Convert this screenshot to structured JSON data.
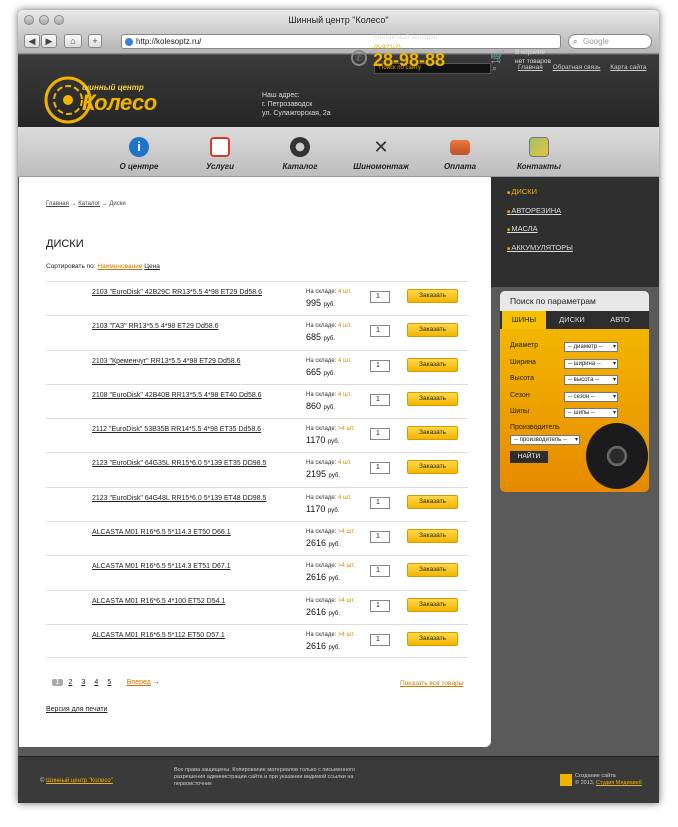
{
  "window": {
    "title": "Шинный центр \"Колесо\"",
    "url": "http://kolesoptz.ru/",
    "search_placeholder": "Google"
  },
  "header": {
    "search_placeholder": "Поиск по сайту",
    "toplinks": [
      "Главная",
      "Обратная связь",
      "Карта сайта"
    ],
    "logo_line1": "шинный центр",
    "logo_line2": "Колесо",
    "address": [
      "Наш адрес:",
      "г. Петрозаводск",
      "ул. Сулажгорская, 2а"
    ],
    "phone_label": "Контактный телефон:",
    "phone_code": "(8-921-2)",
    "phone_number": "28-98-88",
    "cart_line1": "В корзине",
    "cart_line2": "нет товаров"
  },
  "nav": [
    {
      "label": "О центре",
      "icon": "info-icon",
      "color": "#1e73c8"
    },
    {
      "label": "Услуги",
      "icon": "document-icon",
      "color": "#d83a2a"
    },
    {
      "label": "Каталог",
      "icon": "tire-icon",
      "color": "#333333"
    },
    {
      "label": "Шиномонтаж",
      "icon": "wrench-icon",
      "color": "#333333"
    },
    {
      "label": "Оплата",
      "icon": "credit-card-icon",
      "color": "#d06a2a"
    },
    {
      "label": "Контакты",
      "icon": "map-icon",
      "color": "#7aa84a"
    }
  ],
  "breadcrumb": {
    "home": "Главная",
    "catalog": "Каталог",
    "current": "Диски",
    "sep": "→"
  },
  "page_title": "ДИСКИ",
  "sort": {
    "label": "Сортировать по:",
    "by_name": "Наименование",
    "by_price": "Цена"
  },
  "products": [
    {
      "name": "2103 \"EuroDisk\" 42B29C RR13*5.5 4*98 ET29 Dd58.6",
      "stock_label": "На складе:",
      "stock": "4 шт.",
      "price": "995",
      "currency": "руб.",
      "qty": "1",
      "order": "Заказать"
    },
    {
      "name": "2103 \"ГАЗ\" RR13*5.5 4*98 ET29 Dd58.6",
      "stock_label": "На складе:",
      "stock": "4 шт.",
      "price": "685",
      "currency": "руб.",
      "qty": "1",
      "order": "Заказать"
    },
    {
      "name": "2103 \"Кременчуг\" RR13*5.5 4*98 ET29 Dd58.6",
      "stock_label": "На складе:",
      "stock": "4 шт.",
      "price": "665",
      "currency": "руб.",
      "qty": "1",
      "order": "Заказать"
    },
    {
      "name": "2108 \"EuroDisk\" 42B40B RR13*5.5 4*98 ET40 Dd58.6",
      "stock_label": "На складе:",
      "stock": "4 шт.",
      "price": "860",
      "currency": "руб.",
      "qty": "1",
      "order": "Заказать"
    },
    {
      "name": "2112 \"EuroDisk\" 53B35B RR14*5.5 4*98 ET35 Dd58.6",
      "stock_label": "На складе:",
      "stock": ">4 шт.",
      "price": "1170",
      "currency": "руб.",
      "qty": "1",
      "order": "Заказать"
    },
    {
      "name": "2123 \"EuroDisk\" 64G35L RR15*6.0 5*139 ET35 DD98.5",
      "stock_label": "На складе:",
      "stock": "4 шт.",
      "price": "2195",
      "currency": "руб.",
      "qty": "1",
      "order": "Заказать"
    },
    {
      "name": "2123 \"EuroDisk\" 64G48L RR15*6.0 5*139 ET48 DD98.5",
      "stock_label": "На складе:",
      "stock": "4 шт.",
      "price": "1170",
      "currency": "руб.",
      "qty": "1",
      "order": "Заказать"
    },
    {
      "name": "ALCASTA M01 R16*6.5 5*114.3 ET50 D66.1",
      "stock_label": "На складе:",
      "stock": ">4 шт.",
      "price": "2616",
      "currency": "руб.",
      "qty": "1",
      "order": "Заказать"
    },
    {
      "name": "ALCASTA M01 R16*6.5 5*114.3 ET51 D67.1",
      "stock_label": "На складе:",
      "stock": ">4 шт.",
      "price": "2616",
      "currency": "руб.",
      "qty": "1",
      "order": "Заказать"
    },
    {
      "name": "ALCASTA M01 R16*6.5 4*100 ET52 D54.1",
      "stock_label": "На складе:",
      "stock": ">4 шт.",
      "price": "2616",
      "currency": "руб.",
      "qty": "1",
      "order": "Заказать"
    },
    {
      "name": "ALCASTA M01 R16*6.5 5*112 ET50 D57.1",
      "stock_label": "На складе:",
      "stock": ">4 шт.",
      "price": "2616",
      "currency": "руб.",
      "qty": "1",
      "order": "Заказать"
    }
  ],
  "pager": {
    "pages": [
      "1",
      "2",
      "3",
      "4",
      "5"
    ],
    "next": "Вперед",
    "show_all": "Показать все товары"
  },
  "print_version": "Версия для печати",
  "categories": [
    "ДИСКИ",
    "АВТОРЕЗИНА",
    "МАСЛА",
    "АККУМУЛЯТОРЫ"
  ],
  "param_search": {
    "title": "Поиск по параметрам",
    "tabs": [
      "ШИНЫ",
      "ДИСКИ",
      "АВТО"
    ],
    "fields": [
      {
        "label": "Диаметр",
        "value": "-- диаметр --"
      },
      {
        "label": "Ширина",
        "value": "-- ширина --"
      },
      {
        "label": "Высота",
        "value": "-- высота --"
      },
      {
        "label": "Сезон",
        "value": "-- сезон --"
      },
      {
        "label": "Шипы",
        "value": "-- шипы --"
      }
    ],
    "manufacturer_label": "Производитель",
    "manufacturer_value": "-- производитель --",
    "find": "НАЙТИ"
  },
  "footer": {
    "copy_prefix": "©",
    "copy_link": "Шинный центр \"Колесо\"",
    "rights": "Все права защищены. Копирование материалов только с письменного разрешения администрации сайта и при указании видимой ссылки на первоисточник",
    "made_line1": "Создание сайта",
    "made_prefix": "© 2013,",
    "made_link": "Студия Медиавеб"
  },
  "colors": {
    "accent": "#f0b400",
    "link_orange": "#c87800",
    "dark": "#2f2f2f"
  }
}
